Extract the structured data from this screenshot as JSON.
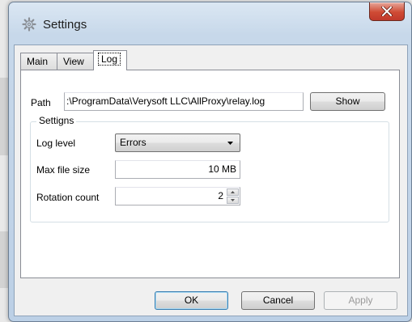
{
  "window": {
    "title": "Settings",
    "title_icon": "gear-icon",
    "close_icon": "close-icon"
  },
  "tabs": [
    {
      "label": "Main",
      "active": false
    },
    {
      "label": "View",
      "active": false
    },
    {
      "label": "Log",
      "active": true
    }
  ],
  "log": {
    "path_label": "Path",
    "path_value": ":\\ProgramData\\Verysoft LLC\\AllProxy\\relay.log",
    "show_button": "Show",
    "group_title": "Settigns",
    "log_level_label": "Log level",
    "log_level_value": "Errors",
    "max_file_size_label": "Max file size",
    "max_file_size_value": "10 MB",
    "rotation_count_label": "Rotation count",
    "rotation_count_value": "2"
  },
  "footer": {
    "ok": "OK",
    "cancel": "Cancel",
    "apply": "Apply"
  },
  "colors": {
    "close_button": "#c0392b",
    "frame": "#bcd0e6",
    "default_button_border": "#3c7fb1"
  }
}
